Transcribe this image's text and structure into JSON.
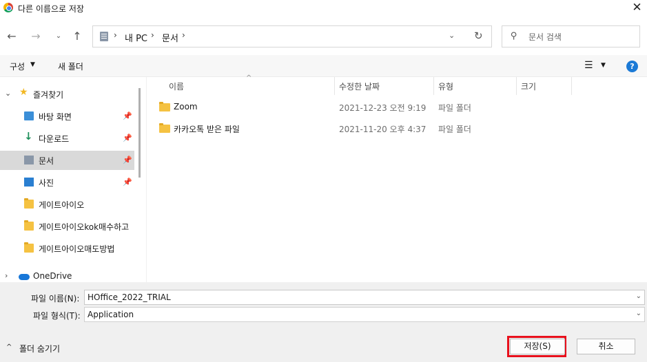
{
  "window": {
    "title": "다른 이름으로 저장",
    "close_label": "✕"
  },
  "nav": {
    "back": "←",
    "forward": "→",
    "recent": "⌄",
    "up": "↑"
  },
  "address": {
    "crumbs": [
      "내 PC",
      "문서"
    ],
    "separator": "›",
    "dropdown": "⌄",
    "refresh": "↻"
  },
  "search": {
    "placeholder": "문서 검색",
    "icon": "⚲"
  },
  "toolbar": {
    "organize_label": "구성",
    "organize_caret": "▼",
    "new_folder_label": "새 폴더",
    "view_icon": "☰",
    "view_caret": "▼",
    "help_label": "?"
  },
  "sidebar": {
    "quick_access": {
      "label": "즐겨찾기",
      "chevron": "⌄",
      "icon": "★"
    },
    "items": [
      {
        "label": "바탕 화면",
        "icon": "desktop-icon",
        "pinned": true
      },
      {
        "label": "다운로드",
        "icon": "download-icon",
        "glyph": "↓",
        "pinned": true
      },
      {
        "label": "문서",
        "icon": "documents-icon",
        "pinned": true,
        "selected": true
      },
      {
        "label": "사진",
        "icon": "pictures-icon",
        "pinned": true
      },
      {
        "label": "게이트아이오",
        "icon": "folder-icon",
        "pinned": false
      },
      {
        "label": "게이트아이오kok매수하고",
        "icon": "folder-icon",
        "pinned": false
      },
      {
        "label": "게이트아이오매도방법",
        "icon": "folder-icon",
        "pinned": false
      }
    ],
    "pin_glyph": "📌",
    "onedrive": {
      "label": "OneDrive",
      "chevron": "›"
    }
  },
  "file_list": {
    "columns": [
      "이름",
      "수정한 날짜",
      "유형",
      "크기"
    ],
    "sort_arrow": "^",
    "rows": [
      {
        "name": "Zoom",
        "modified": "2021-12-23 오전 9:19",
        "type": "파일 폴더",
        "size": ""
      },
      {
        "name": "카카오톡 받은 파일",
        "modified": "2021-11-20 오후 4:37",
        "type": "파일 폴더",
        "size": ""
      }
    ]
  },
  "form": {
    "filename_label": "파일 이름(N):",
    "filename_value": "HOffice_2022_TRIAL",
    "filetype_label": "파일 형식(T):",
    "filetype_value": "Application",
    "caret": "⌄"
  },
  "footer": {
    "hide_folders_label": "폴더 숨기기",
    "hide_caret": "^",
    "save_label": "저장(S)",
    "cancel_label": "취소"
  },
  "colors": {
    "accent": "#1c7ad6",
    "highlight_box": "#e8101c",
    "selection": "#d9d9d9"
  }
}
